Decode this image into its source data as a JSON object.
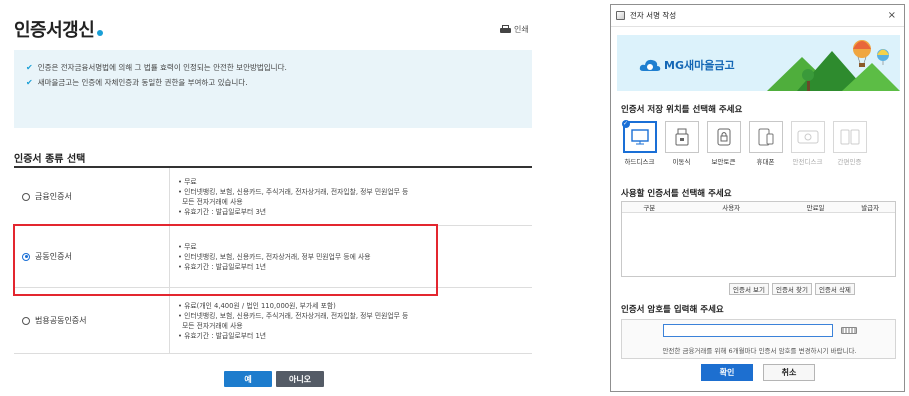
{
  "left_page": {
    "title": "인증서갱신",
    "print_label": "인쇄",
    "notice": [
      "인증은 전자금융서명법에 의해 그 법률 효력이 인정되는 안전한 보안방법입니다.",
      "새마을금고는 인증에 자체인증과 동일한 권한을 부여하고 있습니다."
    ],
    "section_title": "인증서 종류 선택",
    "types": [
      {
        "name": "금융인증서",
        "selected": false,
        "lines": [
          "• 무료",
          "• 인터넷뱅킹, 보험, 신용카드, 주식거래, 전자상거래, 전자입찰, 정부 민원업무 등",
          "모든 전자거래에 사용",
          "• 유효기간 : 발급일로부터 3년"
        ]
      },
      {
        "name": "공동인증서",
        "selected": true,
        "lines": [
          "• 무료",
          "• 인터넷뱅킹, 보험, 신용카드, 전자상거래, 정부 민원업무 등에 사용",
          "• 유효기간 : 발급일로부터 1년"
        ]
      },
      {
        "name": "범용공동인증서",
        "selected": false,
        "lines": [
          "• 유료(개인 4,400원 / 법인 110,000원, 부가세 포함)",
          "• 인터넷뱅킹, 보험, 신용카드, 주식거래, 전자상거래, 전자입찰, 정부 민원업무 등",
          "모든 전자거래에 사용",
          "• 유효기간 : 발급일로부터 1년"
        ]
      }
    ],
    "buttons": {
      "yes": "예",
      "no": "아니오"
    },
    "colors": {
      "accent": "#1d7ccd",
      "highlight": "#e3262f"
    }
  },
  "dialog": {
    "title": "전자 서명 작성",
    "close": "×",
    "brand": "MG새마을금고",
    "storage_heading": "인증서 저장 위치를 선택해 주세요",
    "storage": [
      {
        "label": "하드디스크",
        "icon": "monitor-icon",
        "selected": true,
        "enabled": true
      },
      {
        "label": "이동식",
        "icon": "usb-icon",
        "selected": false,
        "enabled": true
      },
      {
        "label": "보안토큰",
        "icon": "token-icon",
        "selected": false,
        "enabled": true
      },
      {
        "label": "휴대폰",
        "icon": "phone-icon",
        "selected": false,
        "enabled": true
      },
      {
        "label": "안전디스크",
        "icon": "safe-disk-icon",
        "selected": false,
        "enabled": false
      },
      {
        "label": "간편인증",
        "icon": "simple-auth-icon",
        "selected": false,
        "enabled": false
      }
    ],
    "cert_heading": "사용할 인증서를 선택해 주세요",
    "cert_columns": [
      "구분",
      "사용자",
      "만료일",
      "발급자"
    ],
    "cert_buttons": [
      "인증서 보기",
      "인증서 찾기",
      "인증서 삭제"
    ],
    "password_heading": "인증서 암호를 입력해 주세요",
    "password_hint": "안전한 금융거래를 위해 6개월마다 인증서 암호를 변경하시기 바랍니다.",
    "ok": "확인",
    "cancel": "취소"
  }
}
